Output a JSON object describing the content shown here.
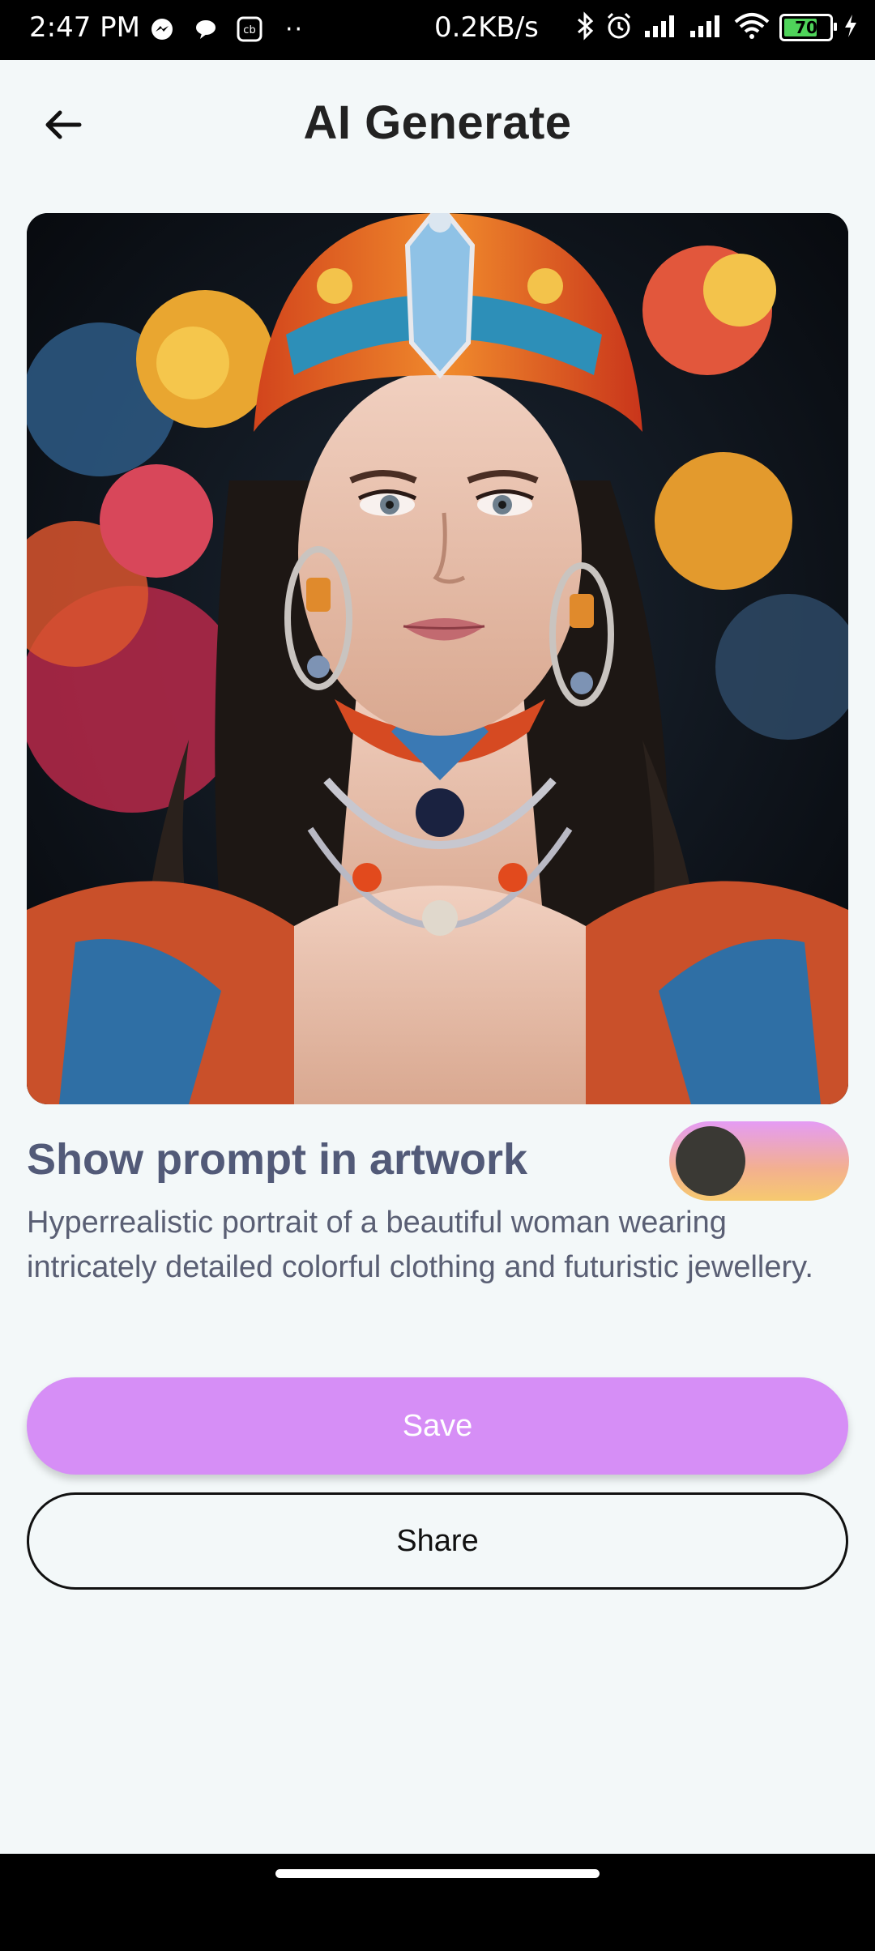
{
  "status_bar": {
    "time": "2:47 PM",
    "net_speed": "0.2KB/s",
    "battery_level": "70",
    "icons": [
      "messenger-icon",
      "chat-bubble-icon",
      "cb-app-icon",
      "more-dots-icon",
      "bluetooth-icon",
      "alarm-icon",
      "signal-icon",
      "signal-icon",
      "wifi-icon",
      "battery-icon",
      "charging-icon"
    ]
  },
  "header": {
    "title": "AI Generate",
    "back_icon": "arrow-left-icon"
  },
  "artwork": {
    "description_icon": "generated-portrait-image"
  },
  "prompt_section": {
    "toggle_label": "Show prompt in artwork",
    "toggle_on": false,
    "prompt_text": "Hyperrealistic portrait of a beautiful woman wearing intricately detailed colorful clothing and futuristic jewellery."
  },
  "actions": {
    "save_label": "Save",
    "share_label": "Share"
  },
  "colors": {
    "background": "#f3f8f9",
    "save_button": "#d68ef6",
    "label_text": "#525a78",
    "title_text": "#222222"
  }
}
